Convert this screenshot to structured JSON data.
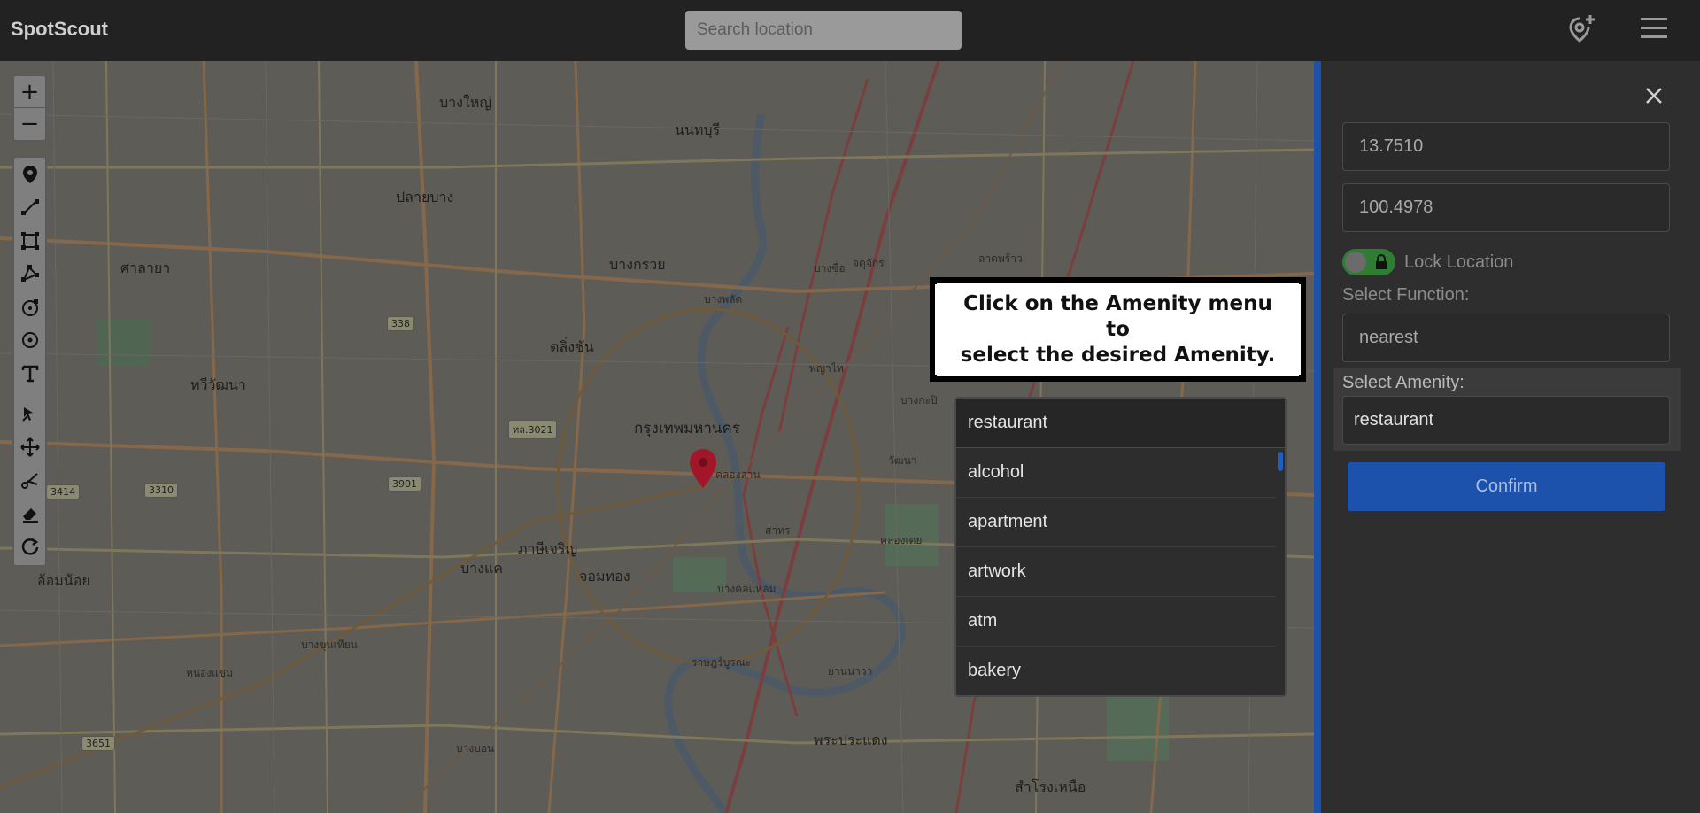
{
  "app": {
    "brand": "SpotScout",
    "search_placeholder": "Search location"
  },
  "icons": {
    "add_location": "add-location-icon",
    "menu": "hamburger-menu-icon"
  },
  "map": {
    "zoom_in": "+",
    "zoom_out": "−",
    "labels": {
      "bangkok": "กรุงเทพมหานคร",
      "nonthaburi": "นนทบุรี",
      "bang_yai": "บางใหญ่",
      "pak_kret": "ปลายบาง",
      "bang_kruai": "บางกรวย",
      "taling_chan": "ตลิ่งชัน",
      "thawi_watthana": "ทวีวัฒนา",
      "phasi_charoen": "ภาษีเจริญ",
      "bang_khae": "บางแค",
      "om_noi": "อ้อมน้อย",
      "chom_thong": "จอมทอง",
      "samrong_nuea": "สำโรงเหนือ",
      "phra_pradaeng": "พระประแดง",
      "nong_khaem": "หนองแขม",
      "sala_ya": "ศาลายา",
      "bang_sue": "บางซื่อ",
      "chatuchak": "จตุจักร",
      "lat_phrao": "ลาดพร้าว",
      "phaya_thai": "พญาไท",
      "khlong_san": "คลองสาน",
      "sathon": "สาทร",
      "bang_phlat": "บางพลัด",
      "bang_kho_laem": "บางคอแหลม",
      "rat_burana": "ราษฎร์บูรณะ",
      "yannawa": "ยานนาวา",
      "khlong_toei": "คลองเตย",
      "watthana": "วัฒนา",
      "bang_kapi": "บางกะปิ",
      "bang_khun_thian": "บางขุนเทียน",
      "bang_bon": "บางบอน"
    },
    "shields": [
      "338",
      "3310",
      "3414",
      "3901",
      "3651",
      "ทล.3021"
    ]
  },
  "tooltip": {
    "line1": "Click on the Amenity menu to",
    "line2": "select the desired Amenity."
  },
  "dropdown": {
    "selected": "restaurant",
    "options": [
      "alcohol",
      "apartment",
      "artwork",
      "atm",
      "bakery"
    ]
  },
  "panel": {
    "latitude": "13.7510",
    "longitude": "100.4978",
    "lock_label": "Lock Location",
    "function_label": "Select Function:",
    "function_value": "nearest",
    "amenity_label": "Select Amenity:",
    "amenity_value": "restaurant",
    "confirm_label": "Confirm"
  },
  "colors": {
    "topbar": "#222222",
    "accent_blue": "#1c52ab",
    "toggle_green": "#2e7d32",
    "marker_red": "#a3162a"
  }
}
